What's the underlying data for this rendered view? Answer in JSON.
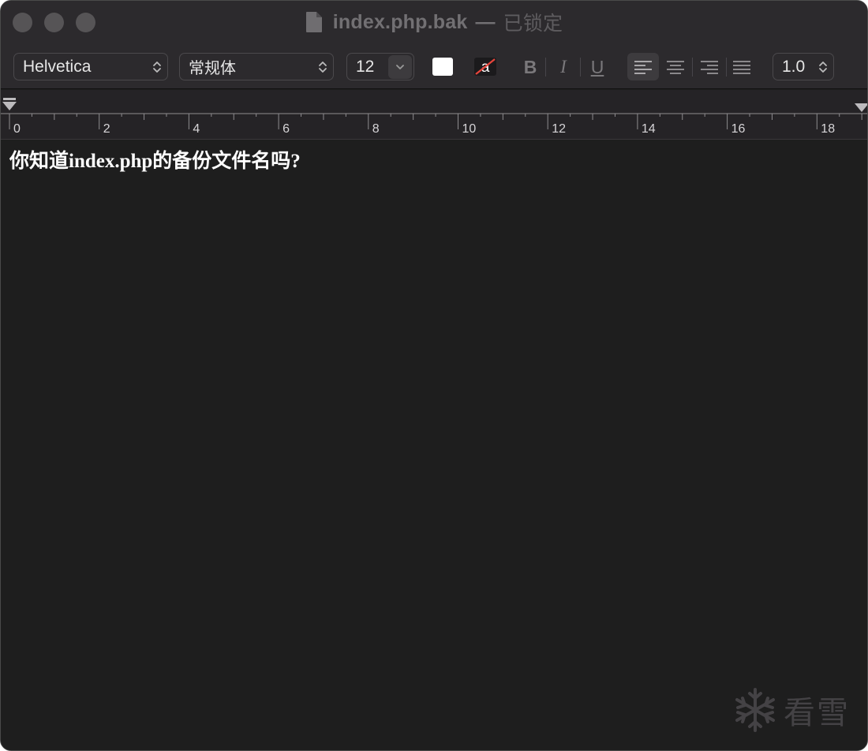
{
  "window": {
    "filename": "index.php.bak",
    "title_separator": "—",
    "status": "已锁定"
  },
  "toolbar": {
    "font_family": "Helvetica",
    "font_style": "常规体",
    "font_size": "12",
    "text_color": "#ffffff",
    "background_color_icon_letter": "a",
    "bold_label": "B",
    "italic_label": "I",
    "underline_label": "U",
    "line_spacing": "1.0",
    "active_alignment": "left"
  },
  "ruler": {
    "labels": [
      "0",
      "2",
      "4",
      "6",
      "8",
      "10",
      "12",
      "14",
      "16",
      "18"
    ]
  },
  "document": {
    "text": "你知道index.php的备份文件名吗?"
  },
  "watermark": {
    "text": "看雪"
  },
  "colors": {
    "window_bg": "#1e1e1e",
    "titlebar_bg": "#2c2a2d",
    "text": "#ffffff",
    "accent_red": "#e8453c"
  }
}
